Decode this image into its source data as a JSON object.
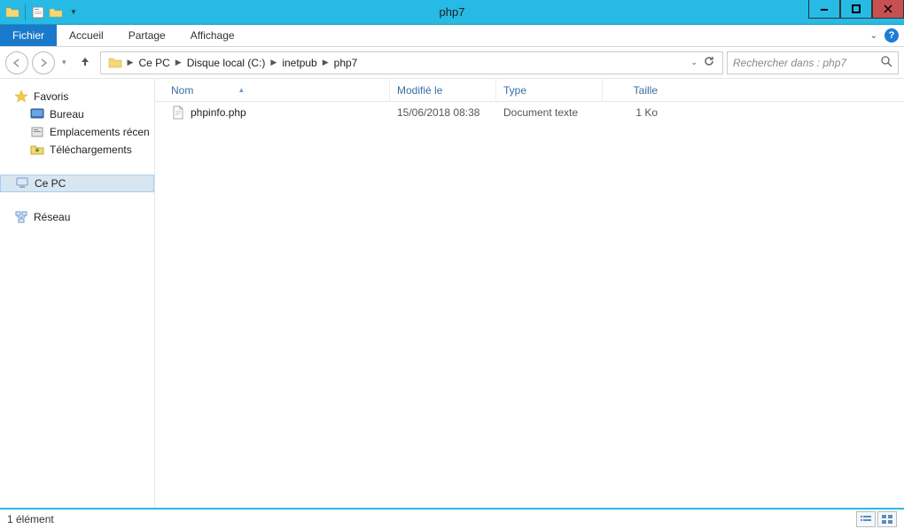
{
  "window": {
    "title": "php7"
  },
  "ribbon": {
    "file": "Fichier",
    "tabs": [
      "Accueil",
      "Partage",
      "Affichage"
    ]
  },
  "breadcrumb": [
    "Ce PC",
    "Disque local (C:)",
    "inetpub",
    "php7"
  ],
  "search": {
    "placeholder": "Rechercher dans : php7"
  },
  "sidebar": {
    "favorites": {
      "label": "Favoris",
      "items": [
        "Bureau",
        "Emplacements récen",
        "Téléchargements"
      ]
    },
    "thispc": {
      "label": "Ce PC"
    },
    "network": {
      "label": "Réseau"
    }
  },
  "columns": {
    "name": "Nom",
    "modified": "Modifié le",
    "type": "Type",
    "size": "Taille"
  },
  "files": [
    {
      "name": "phpinfo.php",
      "modified": "15/06/2018 08:38",
      "type": "Document texte",
      "size": "1 Ko"
    }
  ],
  "status": {
    "count": "1 élément"
  }
}
